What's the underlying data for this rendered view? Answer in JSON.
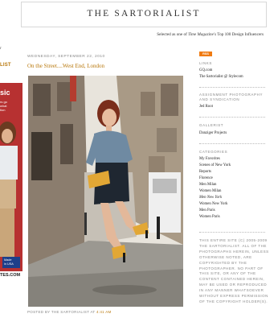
{
  "header": {
    "title": "THE SARTORIALIST",
    "tagline_prefix": "Selected as one of",
    "tagline_mag": "Time Magazine's",
    "tagline_suffix": "Top 100 Design Influencers"
  },
  "left_column": {
    "nav_label": "r",
    "link": "LIST",
    "ad_word": "sic",
    "ad_sub": "rs go\nwhat\ntion",
    "ad_badge": "Made\nin USA",
    "url": "TES.COM"
  },
  "post": {
    "date": "WEDNESDAY, SEPTEMBER 22, 2010",
    "title": "On the Street....West End, London",
    "footer_prefix": "POSTED BY THE SARTORIALIST AT",
    "footer_time": "4:41 AM"
  },
  "sidebar": {
    "feed_badge": "RSS",
    "links_heading": "LINKS",
    "links": [
      "GQ.com",
      "The Sartorialist @ Stylecom"
    ],
    "assignment_heading": "ASSIGNMENT PHOTOGRAPHY AND SYNDICATION",
    "assignment_link": "Jed Root",
    "gallerist_heading": "GALLERIST",
    "gallerist_link": "Danziger Projects",
    "categories_heading": "CATEGORIES",
    "categories": [
      "My Favorites",
      "Scenes of New York",
      "Reports",
      "Florence",
      "Men Milan",
      "Women Milan",
      "Men New York",
      "Women New York",
      "Men Paris",
      "Women Paris"
    ],
    "copyright": "THIS ENTIRE SITE (C) 2005-2009 THE SARTORIALIST. ALL OF THE PHOTOGRAPHS HEREIN, UNLESS OTHERWISE NOTED, ARE COPYRIGHTED BY THE PHOTOGRAPHER. NO PART OF THIS SITE, OR ANY OF THE CONTENT CONTAINED HEREIN, MAY BE USED OR REPRODUCED IN ANY MANNER WHATSOEVER WITHOUT EXPRESS PERMISSION OF THE COPYRIGHT HOLDER(S)."
  },
  "colors": {
    "link": "#b8780c",
    "ad_red": "#b73131",
    "feed_orange": "#f07b12"
  }
}
